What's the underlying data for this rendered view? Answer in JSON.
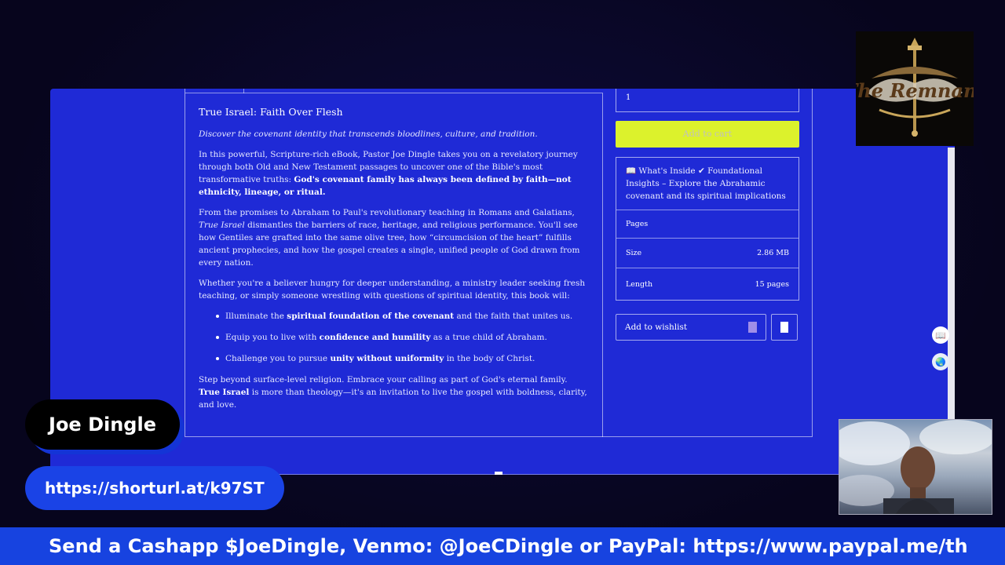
{
  "product": {
    "quantity": "1",
    "add_to_cart": "Add to cart",
    "title": "True Israel: Faith Over Flesh",
    "tagline": "Discover the covenant identity that transcends bloodlines, culture, and tradition.",
    "p1_a": "In this powerful, Scripture-rich eBook, Pastor Joe Dingle takes you on a revelatory journey through both Old and New Testament passages to uncover one of the Bible's most transformative truths: ",
    "p1_b": "God's covenant family has always been defined by faith—not ethnicity, lineage, or ritual.",
    "p2_a": "From the promises to Abraham to Paul's revolutionary teaching in Romans and Galatians, ",
    "p2_em": "True Israel",
    "p2_b": " dismantles the barriers of race, heritage, and religious performance. You'll see how Gentiles are grafted into the same olive tree, how “circumcision of the heart” fulfills ancient prophecies, and how the gospel creates a single, unified people of God drawn from every nation.",
    "p3": "Whether you're a believer hungry for deeper understanding, a ministry leader seeking fresh teaching, or simply someone wrestling with questions of spiritual identity, this book will:",
    "bullets": [
      {
        "pre": "Illuminate the ",
        "bold": "spiritual foundation of the covenant",
        "post": " and the faith that unites us."
      },
      {
        "pre": "Equip you to live with ",
        "bold": "confidence and humility",
        "post": " as a true child of Abraham."
      },
      {
        "pre": "Challenge you to pursue ",
        "bold": "unity without uniformity",
        "post": " in the body of Christ."
      }
    ],
    "p4_a": "Step beyond surface-level religion. Embrace your calling as part of God's eternal family.",
    "p4_bold": "True Israel",
    "p4_b": " is more than theology—it's an invitation to live the gospel with boldness, clarity, and love.",
    "whats_inside": "📖 What's Inside ✔ Foundational Insights – Explore the Abrahamic covenant and its spiritual implications",
    "pages_label": "Pages",
    "size_label": "Size",
    "size_value": "2.86 MB",
    "length_label": "Length",
    "length_value": "15 pages",
    "wishlist": "Add to wishlist"
  },
  "overlay": {
    "name": "Joe Dingle",
    "url": "https://shorturl.at/k97ST",
    "ticker": "Send a Cashapp $JoeDingle, Venmo: @JoeCDingle or PayPal: https://www.paypal.me/th"
  },
  "logo": {
    "text": "The Remnant"
  },
  "colors": {
    "screen_bg": "#1f2ad6",
    "cta": "#dcf22c",
    "ticker_bg": "#1743e0"
  }
}
